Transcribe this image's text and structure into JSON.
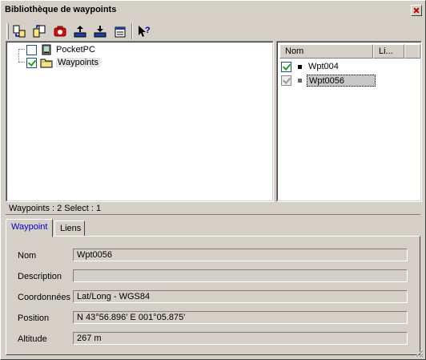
{
  "window": {
    "title": "Bibliothèque de waypoints"
  },
  "toolbar": {
    "buttons": [
      {
        "name": "import-icon"
      },
      {
        "name": "export-icon"
      },
      {
        "name": "delete-icon"
      },
      {
        "name": "upload-icon"
      },
      {
        "name": "download-icon"
      },
      {
        "name": "properties-icon"
      },
      {
        "name": "help-icon"
      }
    ]
  },
  "tree": {
    "items": [
      {
        "label": "PocketPC",
        "checked": false,
        "icon": "pocketpc-icon"
      },
      {
        "label": "Waypoints",
        "checked": true,
        "icon": "folder-icon"
      }
    ]
  },
  "list": {
    "columns": [
      "Nom",
      "Li..."
    ],
    "rows": [
      {
        "name": "Wpt004",
        "checked": true,
        "selected": false
      },
      {
        "name": "Wpt0056",
        "checked": true,
        "selected": true
      }
    ]
  },
  "status": {
    "text": "Waypoints : 2 Select : 1"
  },
  "tabs": [
    {
      "label": "Waypoint",
      "active": true
    },
    {
      "label": "Liens",
      "active": false
    }
  ],
  "details": {
    "name_label": "Nom",
    "name_value": "Wpt0056",
    "description_label": "Description",
    "description_value": "",
    "coords_label": "Coordonnées",
    "coords_value": "Lat/Long - WGS84",
    "position_label": "Position",
    "position_value": "N 43°56.896'  E 001°05.875'",
    "altitude_label": "Altitude",
    "altitude_value": "267 m"
  },
  "colors": {
    "accent_tab": "#0000cc",
    "check": "#21a121",
    "face": "#d4d0c8"
  }
}
